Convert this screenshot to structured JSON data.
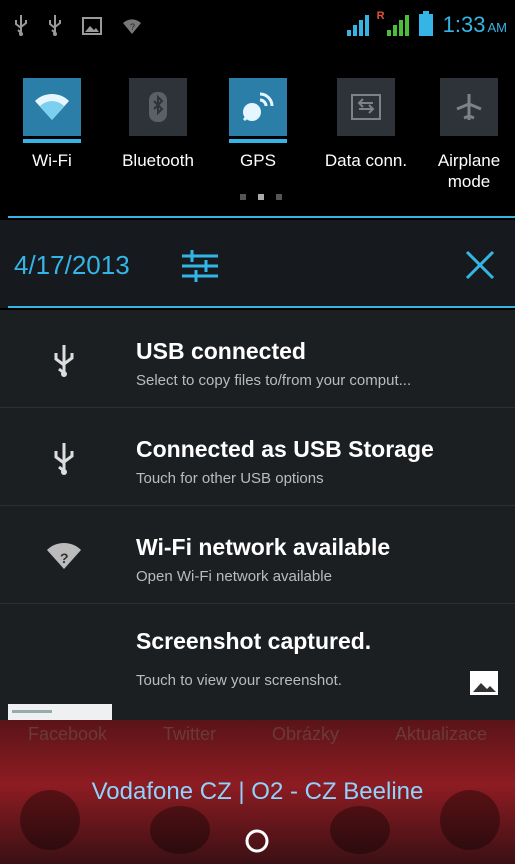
{
  "status_bar": {
    "left_icons": [
      "usb-icon",
      "usb-icon",
      "image-icon",
      "wifi-question-icon"
    ],
    "time": "1:33",
    "ampm": "AM",
    "roaming_indicator": "R"
  },
  "quick_settings": [
    {
      "label": "Wi-Fi",
      "icon": "wifi-icon",
      "active": true
    },
    {
      "label": "Bluetooth",
      "icon": "bluetooth-icon",
      "active": false
    },
    {
      "label": "GPS",
      "icon": "gps-icon",
      "active": true
    },
    {
      "label": "Data conn.",
      "icon": "data-connection-icon",
      "active": false
    },
    {
      "label": "Airplane mode",
      "icon": "airplane-icon",
      "active": false
    }
  ],
  "header": {
    "date": "4/17/2013"
  },
  "notifications": [
    {
      "title": "USB connected",
      "subtitle": "Select to copy files to/from your comput...",
      "icon": "usb-icon"
    },
    {
      "title": "Connected as USB Storage",
      "subtitle": "Touch for other USB options",
      "icon": "usb-icon"
    },
    {
      "title": "Wi-Fi network available",
      "subtitle": "Open Wi-Fi network available",
      "icon": "wifi-question-icon"
    },
    {
      "title": "Screenshot captured.",
      "subtitle": "Touch to view your screenshot.",
      "icon": "image-icon"
    }
  ],
  "home": {
    "carrier": "Vodafone CZ | O2 - CZ Beeline",
    "apps_row": [
      "Facebook",
      "Twitter",
      "Obrázky",
      "Aktualizace"
    ]
  },
  "colors": {
    "accent": "#34b5e5",
    "signal_green": "#4cbf3a",
    "panel_bg": "#1c1f22"
  }
}
